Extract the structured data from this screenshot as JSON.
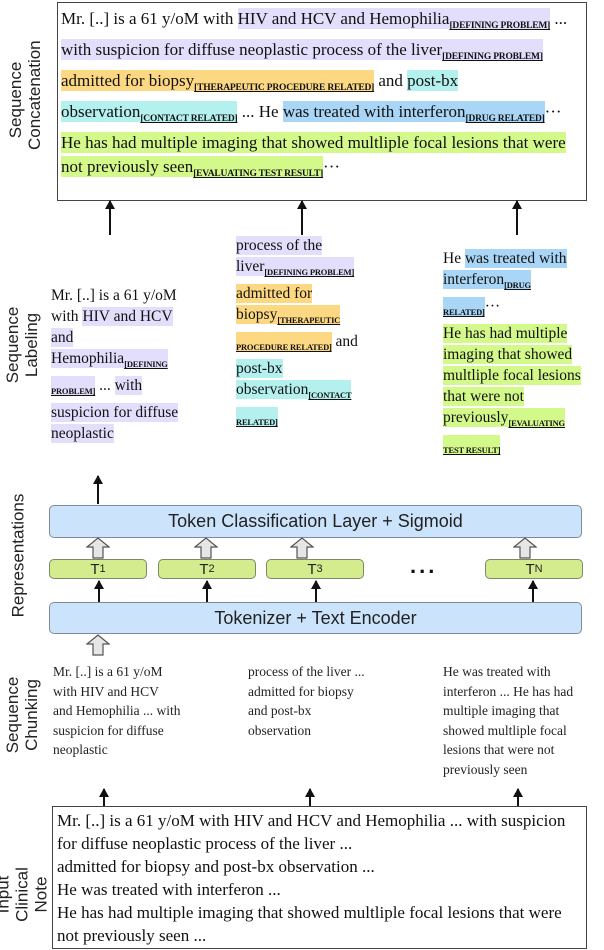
{
  "side_labels": {
    "concat": "Sequence Concatenation",
    "labeling": "Sequence Labeling",
    "representations": "Representations",
    "chunking": "Sequence Chunking",
    "input": "Input Clinical Note"
  },
  "highlight_colors": {
    "lav": "#e2defb",
    "org": "#fdd882",
    "cyan": "#b3f0ee",
    "blue": "#a9d6f6",
    "green": "#d4f98b"
  },
  "concat": {
    "segments": [
      {
        "text": "Mr. [..] is a 61 y/oM with "
      },
      {
        "text": "HIV and HCV and Hemophilia",
        "hl": "lav",
        "label": "[DEFINING PROBLEM]"
      },
      {
        "text": " ... "
      },
      {
        "text": "with suspicion for diffuse neoplastic process of the liver",
        "hl": "lav",
        "label": "[DEFINING PROBLEM]"
      },
      {
        "br": true
      },
      {
        "text": "admitted for biopsy",
        "hl": "org",
        "label": "[THERAPEUTIC PROCEDURE RELATED]"
      },
      {
        "text": " and "
      },
      {
        "text": "post-bx observation",
        "hl": "cyan",
        "label": "[CONTACT RELATED]"
      },
      {
        "text": " ... He "
      },
      {
        "text": "was treated with interferon",
        "hl": "blue",
        "label": "[DRUG RELATED]"
      },
      {
        "text": "···"
      },
      {
        "br": true
      },
      {
        "text": "He has had multiple imaging that showed multliple focal lesions that were not previously seen",
        "hl": "green",
        "label": "[EVALUATING TEST RESULT]"
      },
      {
        "text": "···"
      }
    ]
  },
  "labeling": [
    {
      "segments": [
        {
          "text": "Mr. [..] is a 61 y/oM with "
        },
        {
          "text": "HIV and HCV and Hemophilia",
          "hl": "lav",
          "label": "[DEFINING PROBLEM]"
        },
        {
          "text": " ... "
        },
        {
          "text": "with suspicion for diffuse neoplastic",
          "hl": "lav"
        }
      ]
    },
    {
      "segments": [
        {
          "text": "process of the liver",
          "hl": "lav",
          "label": "[DEFINING PROBLEM]"
        },
        {
          "br": true
        },
        {
          "text": "admitted for biopsy",
          "hl": "org",
          "label": "[THERAPEUTIC PROCEDURE RELATED]"
        },
        {
          "text": " and "
        },
        {
          "text": "post-bx observation",
          "hl": "cyan",
          "label": "[CONTACT RELATED]"
        }
      ]
    },
    {
      "segments": [
        {
          "text": "He "
        },
        {
          "text": "was treated with interferon",
          "hl": "blue",
          "label": "[DRUG RELATED]"
        },
        {
          "text": "···"
        },
        {
          "br": true
        },
        {
          "text": "He has had multiple imaging that showed multliple focal lesions that were not previously",
          "hl": "green",
          "label": "[EVALUATING TEST RESULT]"
        }
      ]
    }
  ],
  "representations": {
    "classifier": "Token Classification Layer + Sigmoid",
    "encoder": "Tokenizer + Text Encoder",
    "tokens": [
      {
        "base": "T",
        "sub": "1"
      },
      {
        "base": "T",
        "sub": "2"
      },
      {
        "base": "T",
        "sub": "3"
      },
      {
        "base": "T",
        "sub": "N"
      }
    ],
    "ellipsis": "..."
  },
  "chunks": [
    "Mr. [..] is a 61 y/oM with HIV and HCV and Hemophilia ... with suspicion for diffuse neoplastic",
    "process of the liver ... admitted for biopsy  and post-bx observation",
    "He was treated with interferon ... He has had multiple imaging that showed multliple focal lesions that were not previously seen"
  ],
  "input_note": [
    "Mr. [..] is a 61 y/oM with HIV and HCV and Hemophilia ... with suspicion for diffuse neoplastic process of the liver ...",
    "admitted for biopsy  and post-bx observation  ...",
    "He was treated with interferon ...",
    "He has had multiple imaging that showed multliple focal lesions that were not previously seen  ..."
  ]
}
